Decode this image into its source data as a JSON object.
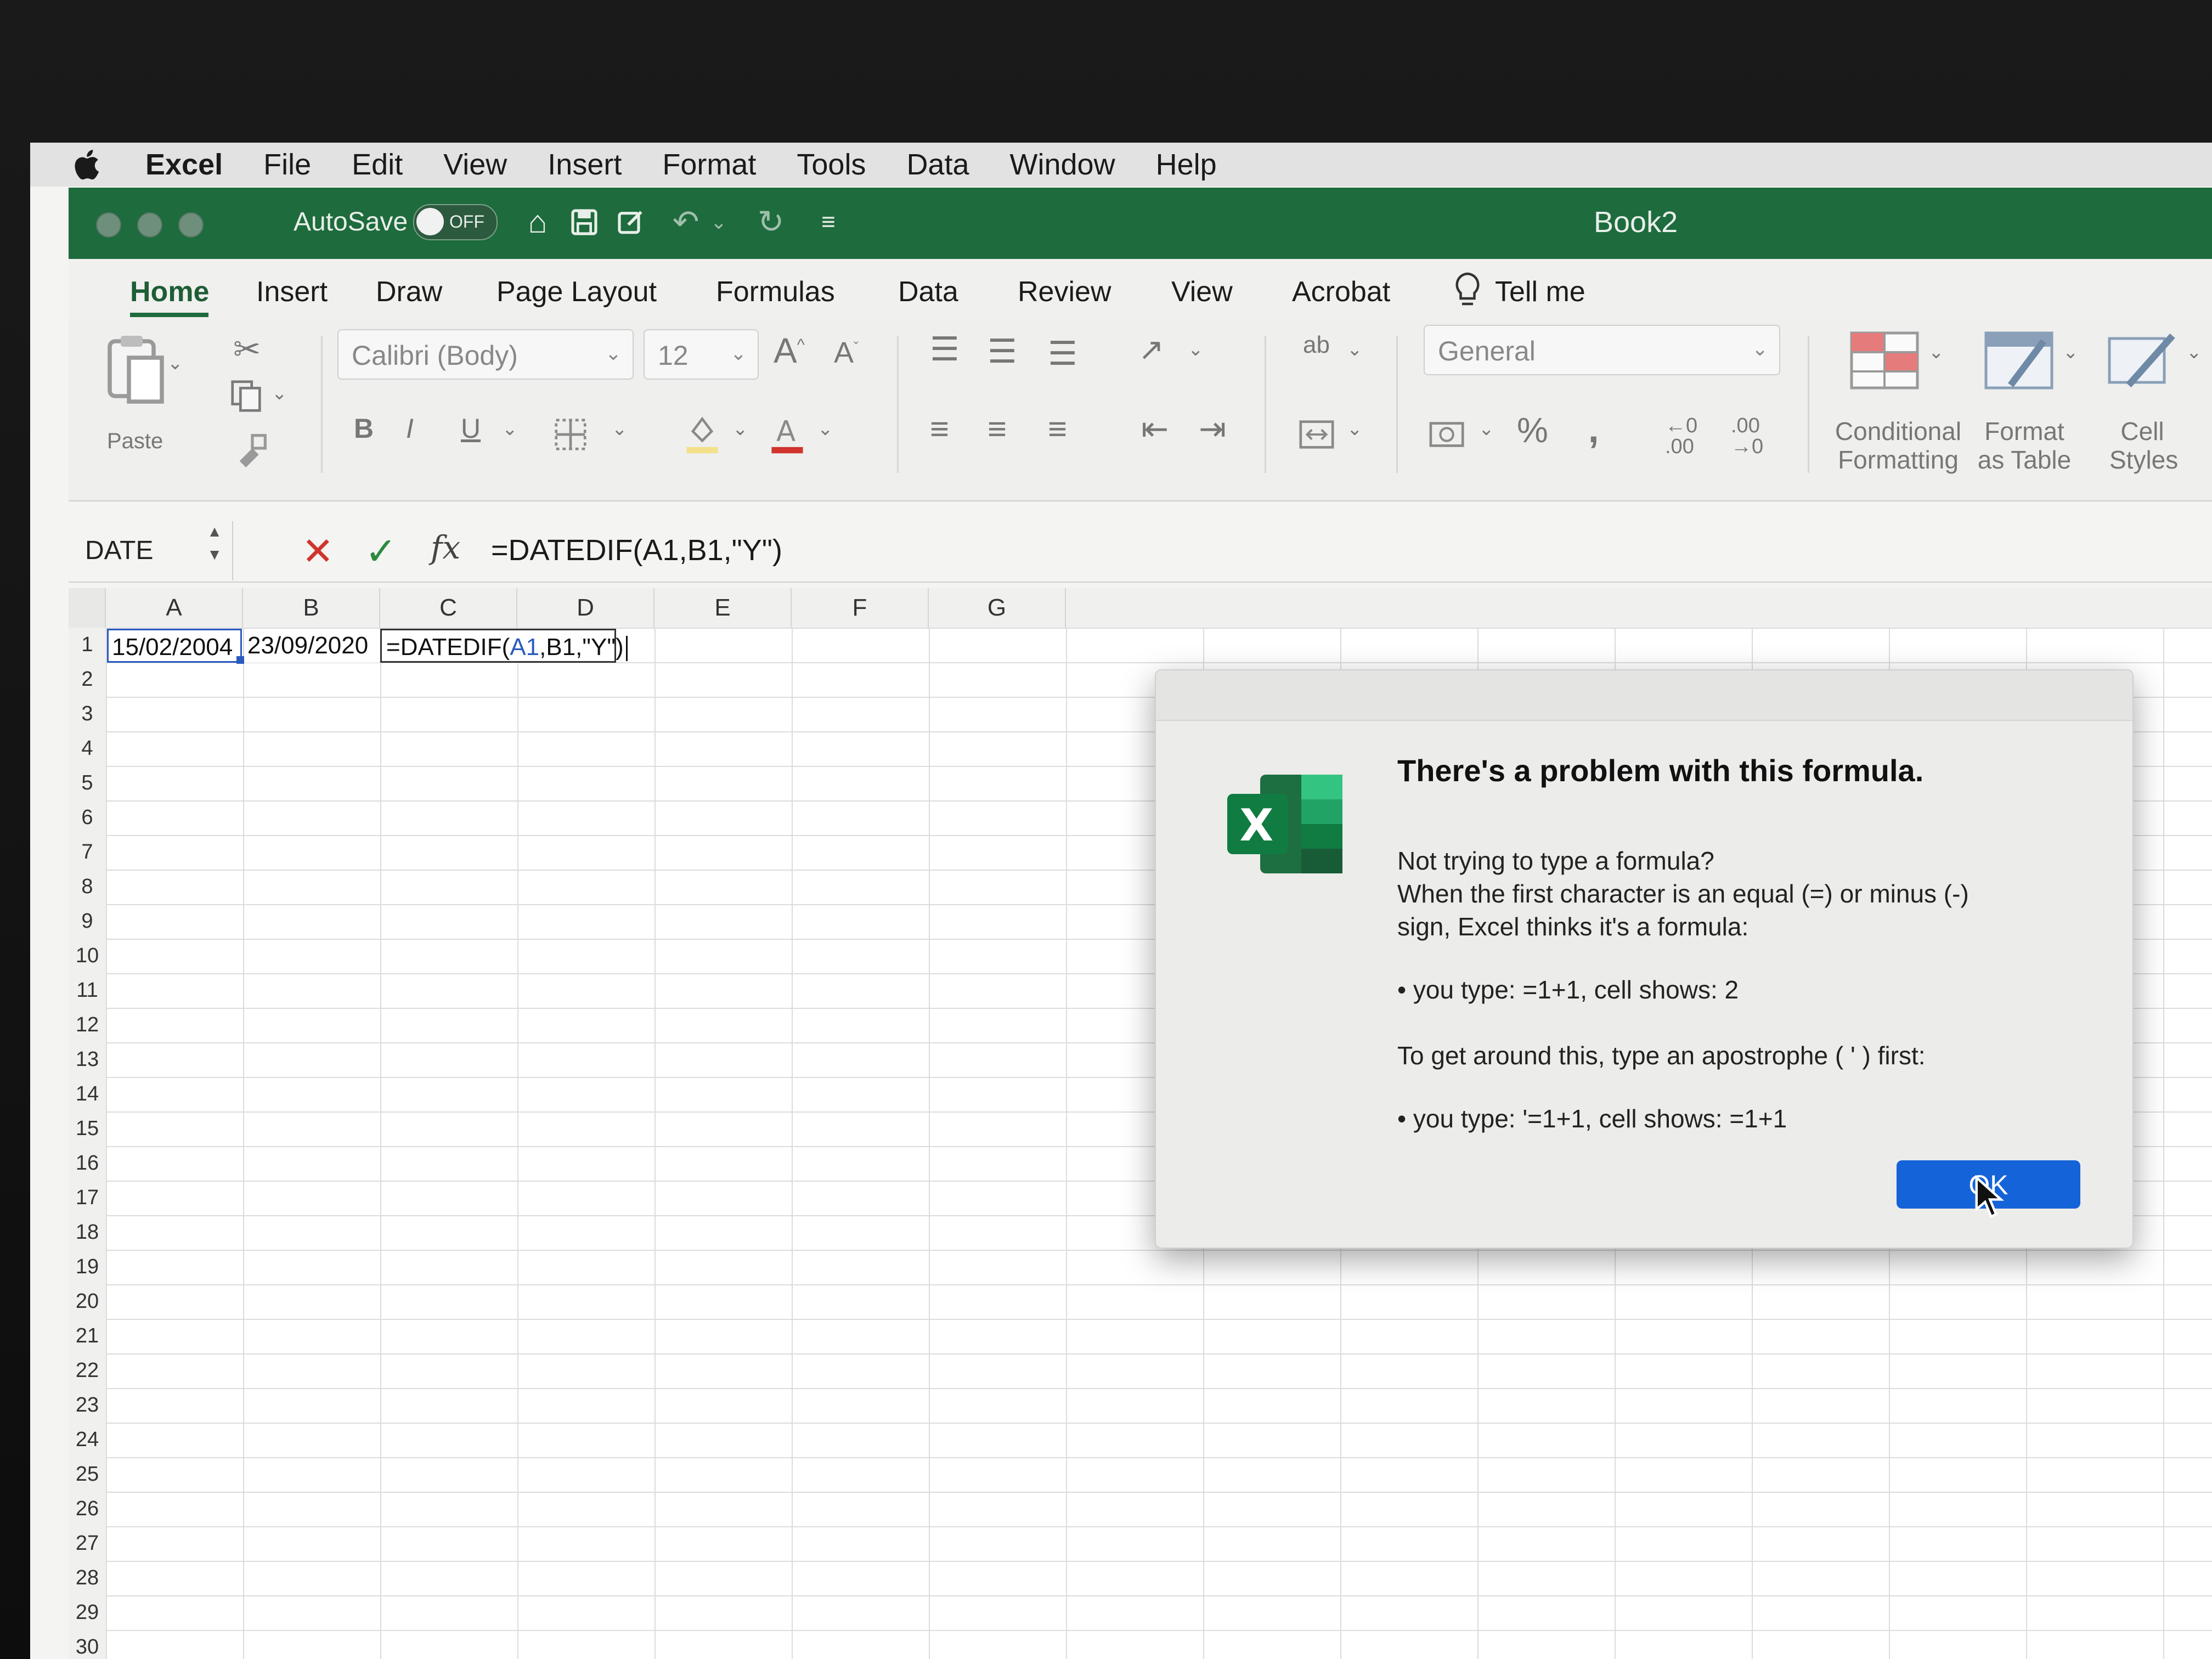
{
  "menubar": {
    "app": "Excel",
    "items": [
      "File",
      "Edit",
      "View",
      "Insert",
      "Format",
      "Tools",
      "Data",
      "Window",
      "Help"
    ]
  },
  "titlebar": {
    "autosave_label": "AutoSave",
    "autosave_state": "OFF",
    "doc_title": "Book2"
  },
  "ribbon_tabs": [
    "Home",
    "Insert",
    "Draw",
    "Page Layout",
    "Formulas",
    "Data",
    "Review",
    "View",
    "Acrobat",
    "Tell me"
  ],
  "ribbon": {
    "paste_label": "Paste",
    "font_name": "Calibri (Body)",
    "font_size": "12",
    "bold": "B",
    "italic": "I",
    "underline": "U",
    "number_format": "General",
    "percent": "%",
    "conditional_formatting": [
      "Conditional",
      "Formatting"
    ],
    "format_as_table": [
      "Format",
      "as Table"
    ],
    "cell_styles": [
      "Cell",
      "Styles"
    ]
  },
  "formula_bar": {
    "name_box": "DATE",
    "fx": "fx",
    "formula": "=DATEDIF(A1,B1,\"Y\")"
  },
  "grid": {
    "columns": [
      "A",
      "B",
      "C",
      "D",
      "E",
      "F",
      "G"
    ],
    "rows": [
      "1",
      "2",
      "3",
      "4",
      "5",
      "6",
      "7",
      "8",
      "9",
      "10",
      "11",
      "12",
      "13",
      "14",
      "15",
      "16",
      "17",
      "18",
      "19",
      "20",
      "21",
      "22",
      "23",
      "24",
      "25",
      "26",
      "27",
      "28",
      "29",
      "30"
    ],
    "a1": "15/02/2004",
    "b1": "23/09/2020",
    "c1_part1": "=DATEDIF(",
    "c1_ref": "A1",
    "c1_part2": ",B1,\"Y\")"
  },
  "dialog": {
    "title": "There's a problem with this formula.",
    "line1": "Not trying to type a formula?",
    "line2": "When the first character is an equal (=) or minus (-)",
    "line3": "sign, Excel thinks it's a formula:",
    "bullet1": "• you type:   =1+1, cell shows:   2",
    "line4": "To get around this, type an apostrophe ( ' ) first:",
    "bullet2": "• you type:   '=1+1, cell shows:   =1+1",
    "ok_label": "OK",
    "logo_letter": "X"
  },
  "colors": {
    "excel_green": "#1e6b3d",
    "ok_blue": "#1563d8",
    "cancel_red": "#d0342c",
    "confirm_green": "#2b8a3e"
  }
}
